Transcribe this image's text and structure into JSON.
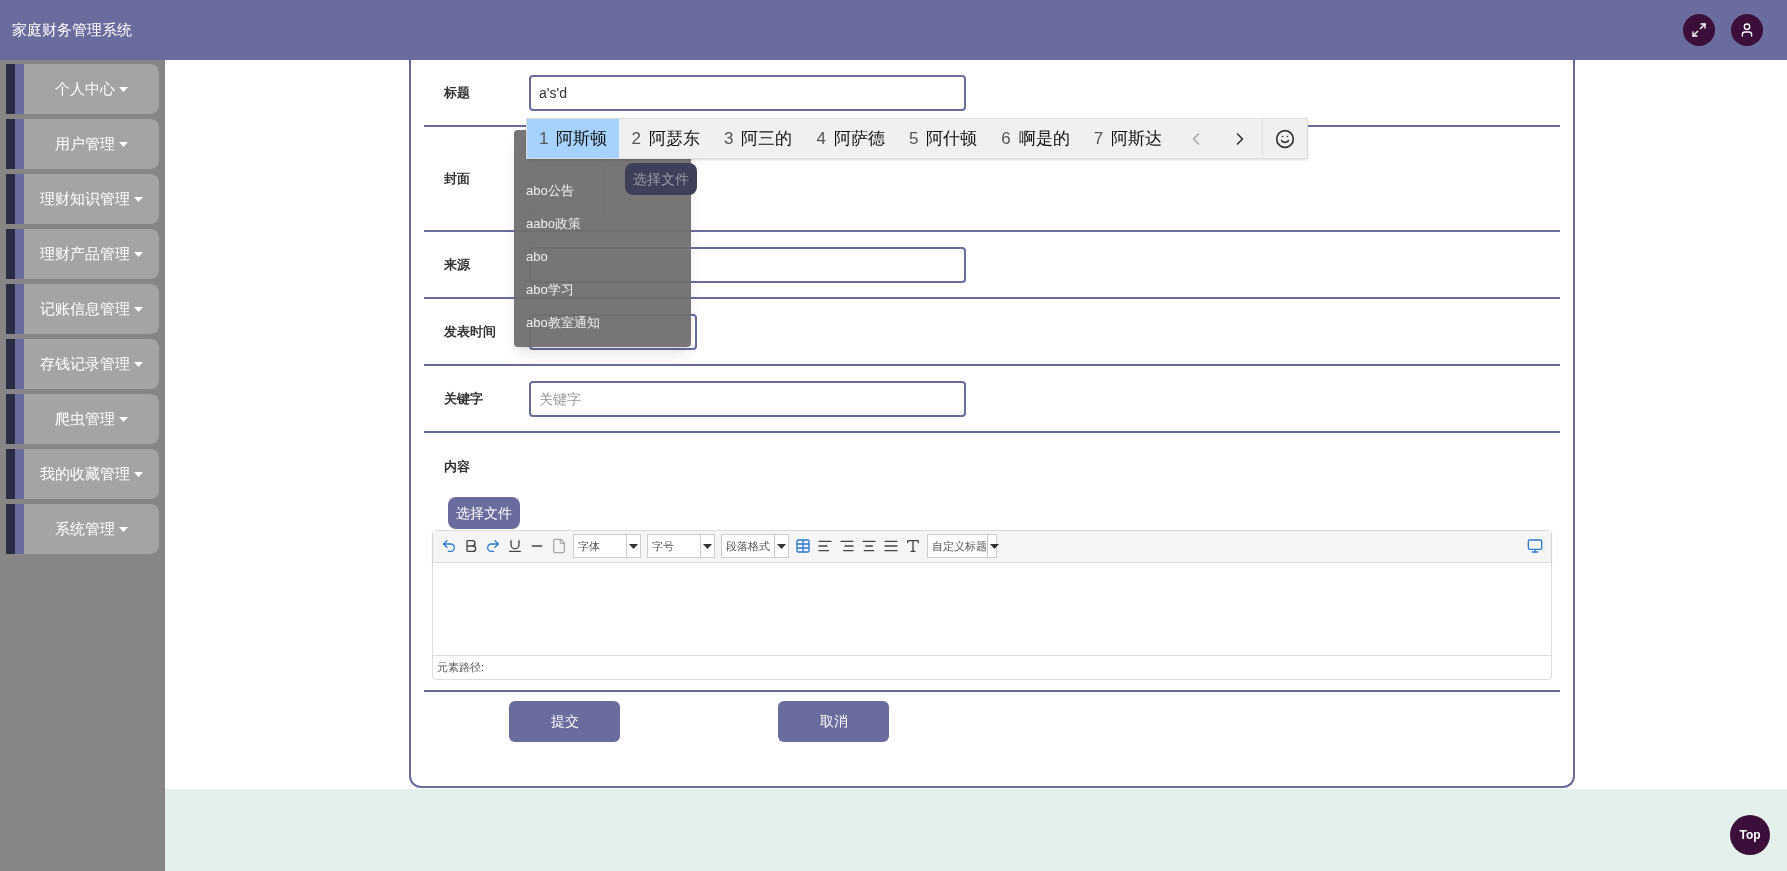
{
  "header": {
    "title": "家庭财务管理系统"
  },
  "sidebar": {
    "items": [
      {
        "label": "个人中心"
      },
      {
        "label": "用户管理"
      },
      {
        "label": "理财知识管理"
      },
      {
        "label": "理财产品管理"
      },
      {
        "label": "记账信息管理"
      },
      {
        "label": "存钱记录管理"
      },
      {
        "label": "爬虫管理"
      },
      {
        "label": "我的收藏管理"
      },
      {
        "label": "系统管理"
      }
    ]
  },
  "form": {
    "fields": [
      {
        "kind": "text",
        "label": "标题",
        "value": "a's'd"
      },
      {
        "kind": "file",
        "label": "封面",
        "button": "选择文件"
      },
      {
        "kind": "text",
        "label": "来源"
      },
      {
        "kind": "date",
        "label": "发表时间"
      },
      {
        "kind": "text",
        "label": "关键字",
        "placeholder": "关键字"
      }
    ],
    "content": {
      "label": "内容",
      "upload_button": "选择文件",
      "toolbar": {
        "selects": [
          "字体",
          "字号",
          "段落格式"
        ],
        "custom_select": "自定义标题"
      },
      "path_label": "元素路径:"
    },
    "buttons": [
      "提交",
      "取消"
    ]
  },
  "ime": {
    "candidates": [
      {
        "index": "1",
        "text": "阿斯顿",
        "selected": true
      },
      {
        "index": "2",
        "text": "阿瑟东",
        "selected": false
      },
      {
        "index": "3",
        "text": "阿三的",
        "selected": false
      },
      {
        "index": "4",
        "text": "阿萨德",
        "selected": false
      },
      {
        "index": "5",
        "text": "阿什顿",
        "selected": false
      },
      {
        "index": "6",
        "text": "啊是的",
        "selected": false
      },
      {
        "index": "7",
        "text": "阿斯达",
        "selected": false
      }
    ]
  },
  "autocomplete": {
    "items": [
      "abo公告",
      "aabo政策",
      "abo",
      "abo学习",
      "abo教室通知"
    ]
  },
  "top_button": "Top"
}
